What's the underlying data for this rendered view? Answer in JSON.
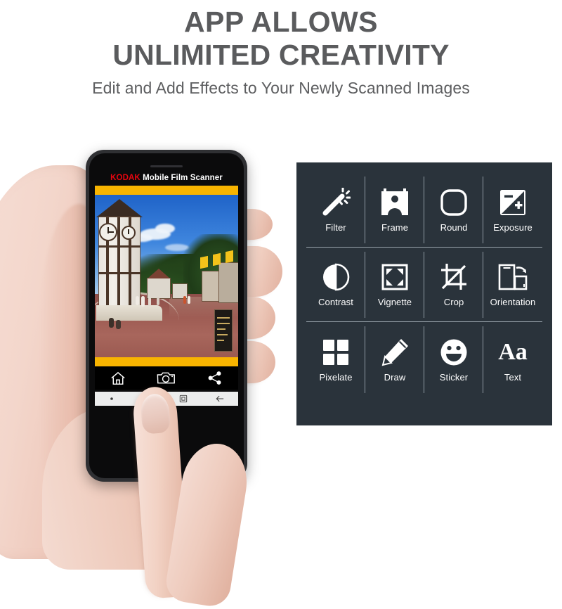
{
  "headline": {
    "line1": "APP ALLOWS",
    "line2": "UNLIMITED CREATIVITY",
    "subtitle": "Edit and Add Effects to Your Newly Scanned Images",
    "color": "#5a5b5d"
  },
  "phone": {
    "app_title_brand": "KODAK",
    "app_title_rest": "Mobile Film Scanner",
    "brand_color": "#e8050f",
    "accent_bar_color": "#f8b400",
    "screen_background": "#000000",
    "photo_description": "Village street scene with tudor clock tower, blue sky and brick plaza",
    "app_nav": [
      {
        "name": "home-icon",
        "label": "Home"
      },
      {
        "name": "camera-icon",
        "label": "Camera"
      },
      {
        "name": "share-icon",
        "label": "Share"
      }
    ],
    "system_nav": [
      {
        "name": "dot-icon",
        "label": "Menu"
      },
      {
        "name": "recent-apps-icon",
        "label": "Recents"
      },
      {
        "name": "home-square-icon",
        "label": "Home"
      },
      {
        "name": "back-arrow-icon",
        "label": "Back"
      }
    ]
  },
  "panel": {
    "background_color": "#2a333b",
    "divider_color": "#9aa4ac",
    "icon_color": "#ffffff",
    "tools": [
      {
        "label": "Filter",
        "icon": "magic-wand-icon"
      },
      {
        "label": "Frame",
        "icon": "photo-frame-icon"
      },
      {
        "label": "Round",
        "icon": "rounded-square-icon"
      },
      {
        "label": "Exposure",
        "icon": "exposure-icon"
      },
      {
        "label": "Contrast",
        "icon": "contrast-icon"
      },
      {
        "label": "Vignette",
        "icon": "vignette-icon"
      },
      {
        "label": "Crop",
        "icon": "crop-icon"
      },
      {
        "label": "Orientation",
        "icon": "orientation-icon"
      },
      {
        "label": "Pixelate",
        "icon": "pixelate-icon"
      },
      {
        "label": "Draw",
        "icon": "pencil-icon"
      },
      {
        "label": "Sticker",
        "icon": "smiley-icon"
      },
      {
        "label": "Text",
        "icon": "text-aa-icon"
      }
    ]
  }
}
